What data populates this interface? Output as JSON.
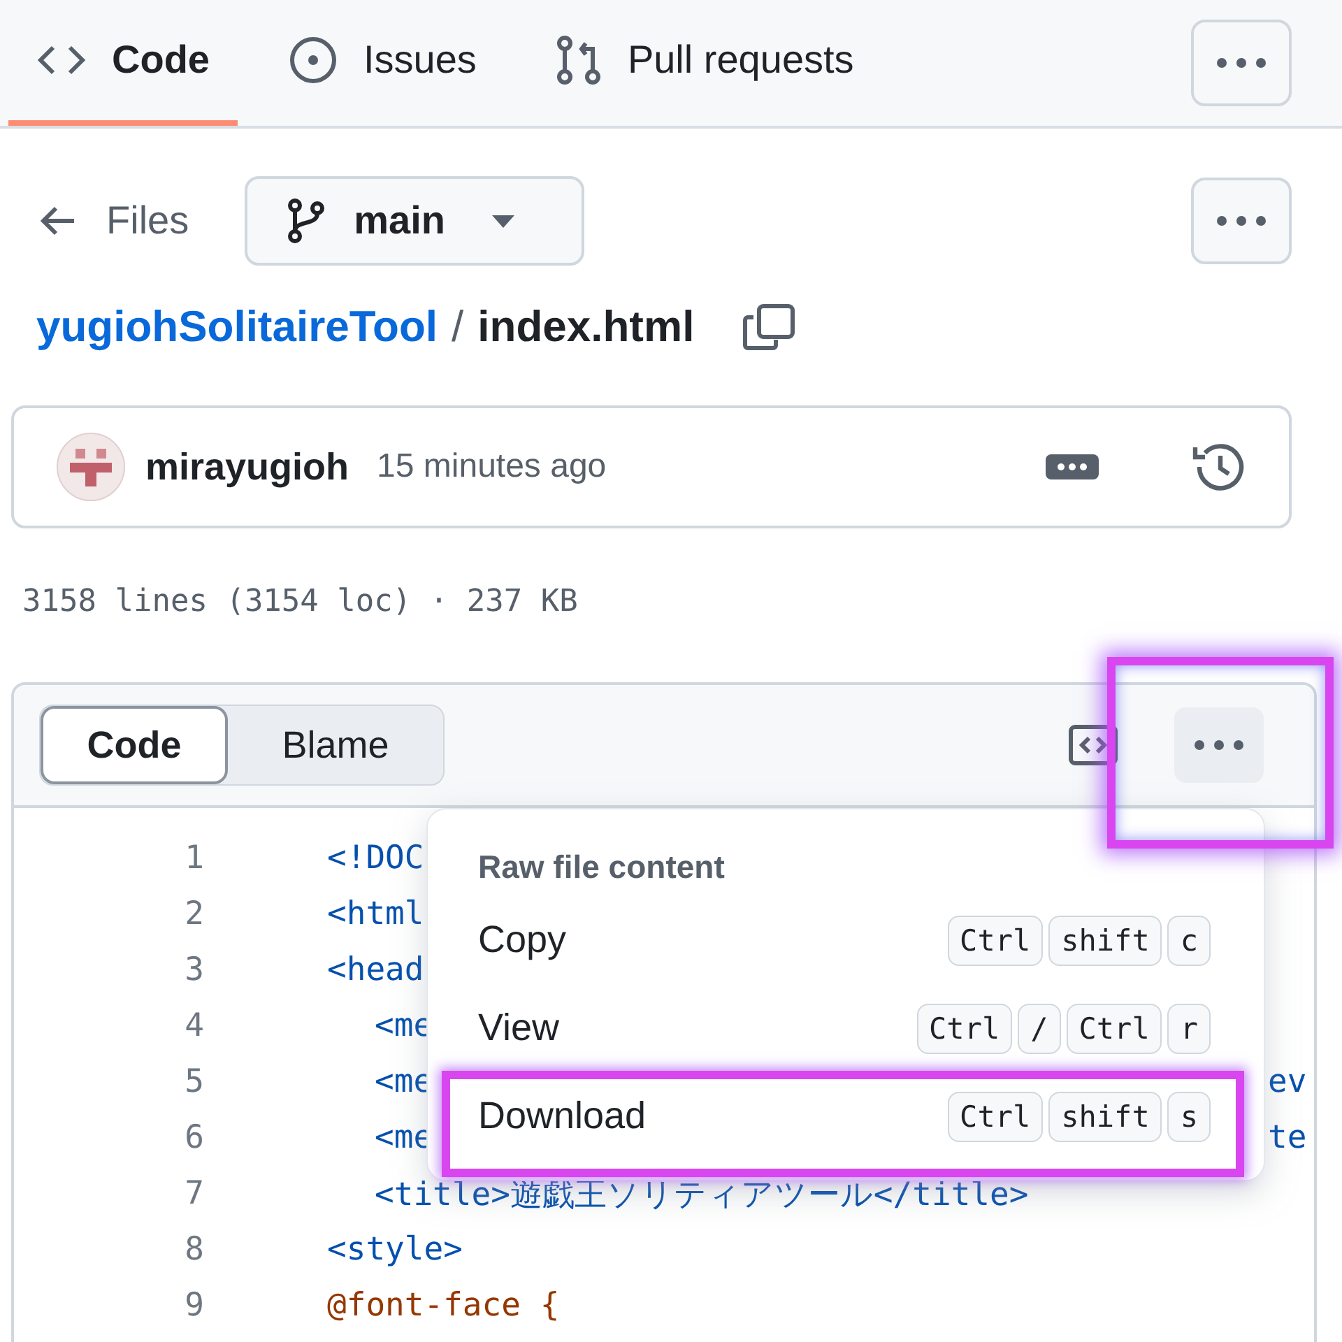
{
  "nav": {
    "tabs": [
      {
        "label": "Code",
        "selected": true
      },
      {
        "label": "Issues",
        "selected": false
      },
      {
        "label": "Pull requests",
        "selected": false
      }
    ]
  },
  "file_nav": {
    "back_label": "Files",
    "branch": "main"
  },
  "breadcrumb": {
    "repo": "yugiohSolitaireTool",
    "separator": "/",
    "file": "index.html"
  },
  "commit": {
    "author": "mirayugioh",
    "time": "15 minutes ago"
  },
  "stats": "3158 lines (3154 loc) · 237 KB",
  "viewer": {
    "modes": [
      {
        "label": "Code",
        "selected": true
      },
      {
        "label": "Blame",
        "selected": false
      }
    ],
    "more_highlighted": true
  },
  "code_lines": [
    {
      "number": "1",
      "text": "<!DOC",
      "kind": "tag"
    },
    {
      "number": "2",
      "text": "<html",
      "kind": "tag"
    },
    {
      "number": "3",
      "text": "<head",
      "kind": "tag",
      "indent": false
    },
    {
      "number": "4",
      "text": "<me",
      "kind": "tag",
      "indent": true
    },
    {
      "number": "5",
      "text": "<me",
      "kind": "tag",
      "indent": true,
      "tail": "ev"
    },
    {
      "number": "6",
      "text": "<me",
      "kind": "tag",
      "indent": true,
      "tail": "te"
    },
    {
      "number": "7",
      "text": "<title>遊戯王ソリティアツール</title>",
      "kind": "tag",
      "indent": true
    },
    {
      "number": "8",
      "text": "<style>",
      "kind": "tag"
    },
    {
      "number": "9",
      "text": "@font-face {",
      "kind": "rule"
    }
  ],
  "menu": {
    "heading": "Raw file content",
    "items": [
      {
        "label": "Copy",
        "keys": [
          "Ctrl",
          "shift",
          "c"
        ],
        "highlighted": false
      },
      {
        "label": "View",
        "keys": [
          "Ctrl",
          "/",
          "Ctrl",
          "r"
        ],
        "highlighted": false
      },
      {
        "label": "Download",
        "keys": [
          "Ctrl",
          "shift",
          "s"
        ],
        "highlighted": true
      }
    ]
  }
}
